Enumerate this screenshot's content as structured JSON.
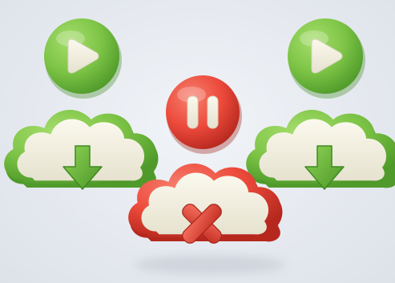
{
  "colors": {
    "background": "#e6eaf0",
    "green": "#7dc446",
    "green_dark": "#4f9a2a",
    "green_light": "#a6dd6c",
    "red": "#ec4a3b",
    "red_dark": "#b6281e",
    "red_light": "#f7806f",
    "cream": "#f4f1e3",
    "cream_shadow": "#ddd9c6"
  },
  "icons": [
    {
      "name": "play-icon",
      "role": "play button",
      "color": "green"
    },
    {
      "name": "pause-icon",
      "role": "pause button",
      "color": "red"
    },
    {
      "name": "play-icon",
      "role": "play button",
      "color": "green"
    },
    {
      "name": "cloud-download-icon",
      "role": "download",
      "color": "green"
    },
    {
      "name": "cloud-cancel-icon",
      "role": "cancel download",
      "color": "red"
    },
    {
      "name": "cloud-download-icon",
      "role": "download",
      "color": "green"
    }
  ]
}
